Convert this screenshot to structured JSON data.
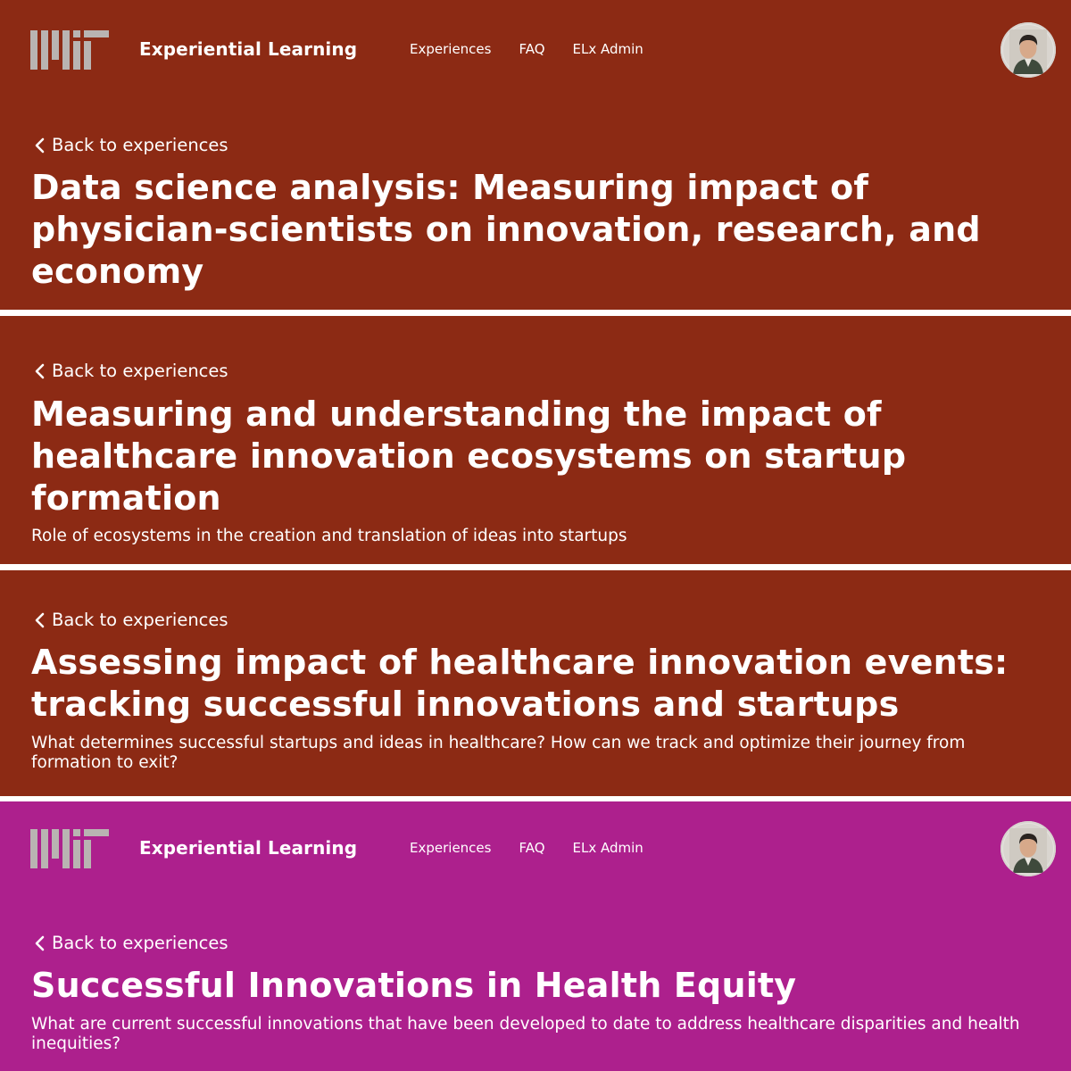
{
  "header": {
    "brand": "Experiential Learning",
    "nav": [
      "Experiences",
      "FAQ",
      "ELx Admin"
    ]
  },
  "back_label": "Back to experiences",
  "panels": [
    {
      "title": "Data science analysis: Measuring impact of physician-scientists on innovation, research, and economy",
      "background": "#8c2a14"
    },
    {
      "title": "Measuring and understanding the impact of healthcare innovation ecosystems on startup formation",
      "subtitle": "Role of ecosystems in the creation and translation of ideas into startups",
      "background": "#8c2a14"
    },
    {
      "title": "Assessing impact of healthcare innovation events: tracking successful innovations and startups",
      "subtitle": "What determines successful startups and ideas in healthcare? How can we track and optimize their journey from formation to exit?",
      "background": "#8c2a14"
    },
    {
      "title": "Successful Innovations in Health Equity",
      "subtitle": "What are current successful innovations that have been developed to date to address healthcare disparities and health inequities?",
      "background": "#ad208d"
    }
  ],
  "colors": {
    "logo_gray": "#b9b4b2",
    "divider": "#ffffff"
  },
  "icons": [
    "mit-logo",
    "chevron-left-icon",
    "user-avatar"
  ]
}
